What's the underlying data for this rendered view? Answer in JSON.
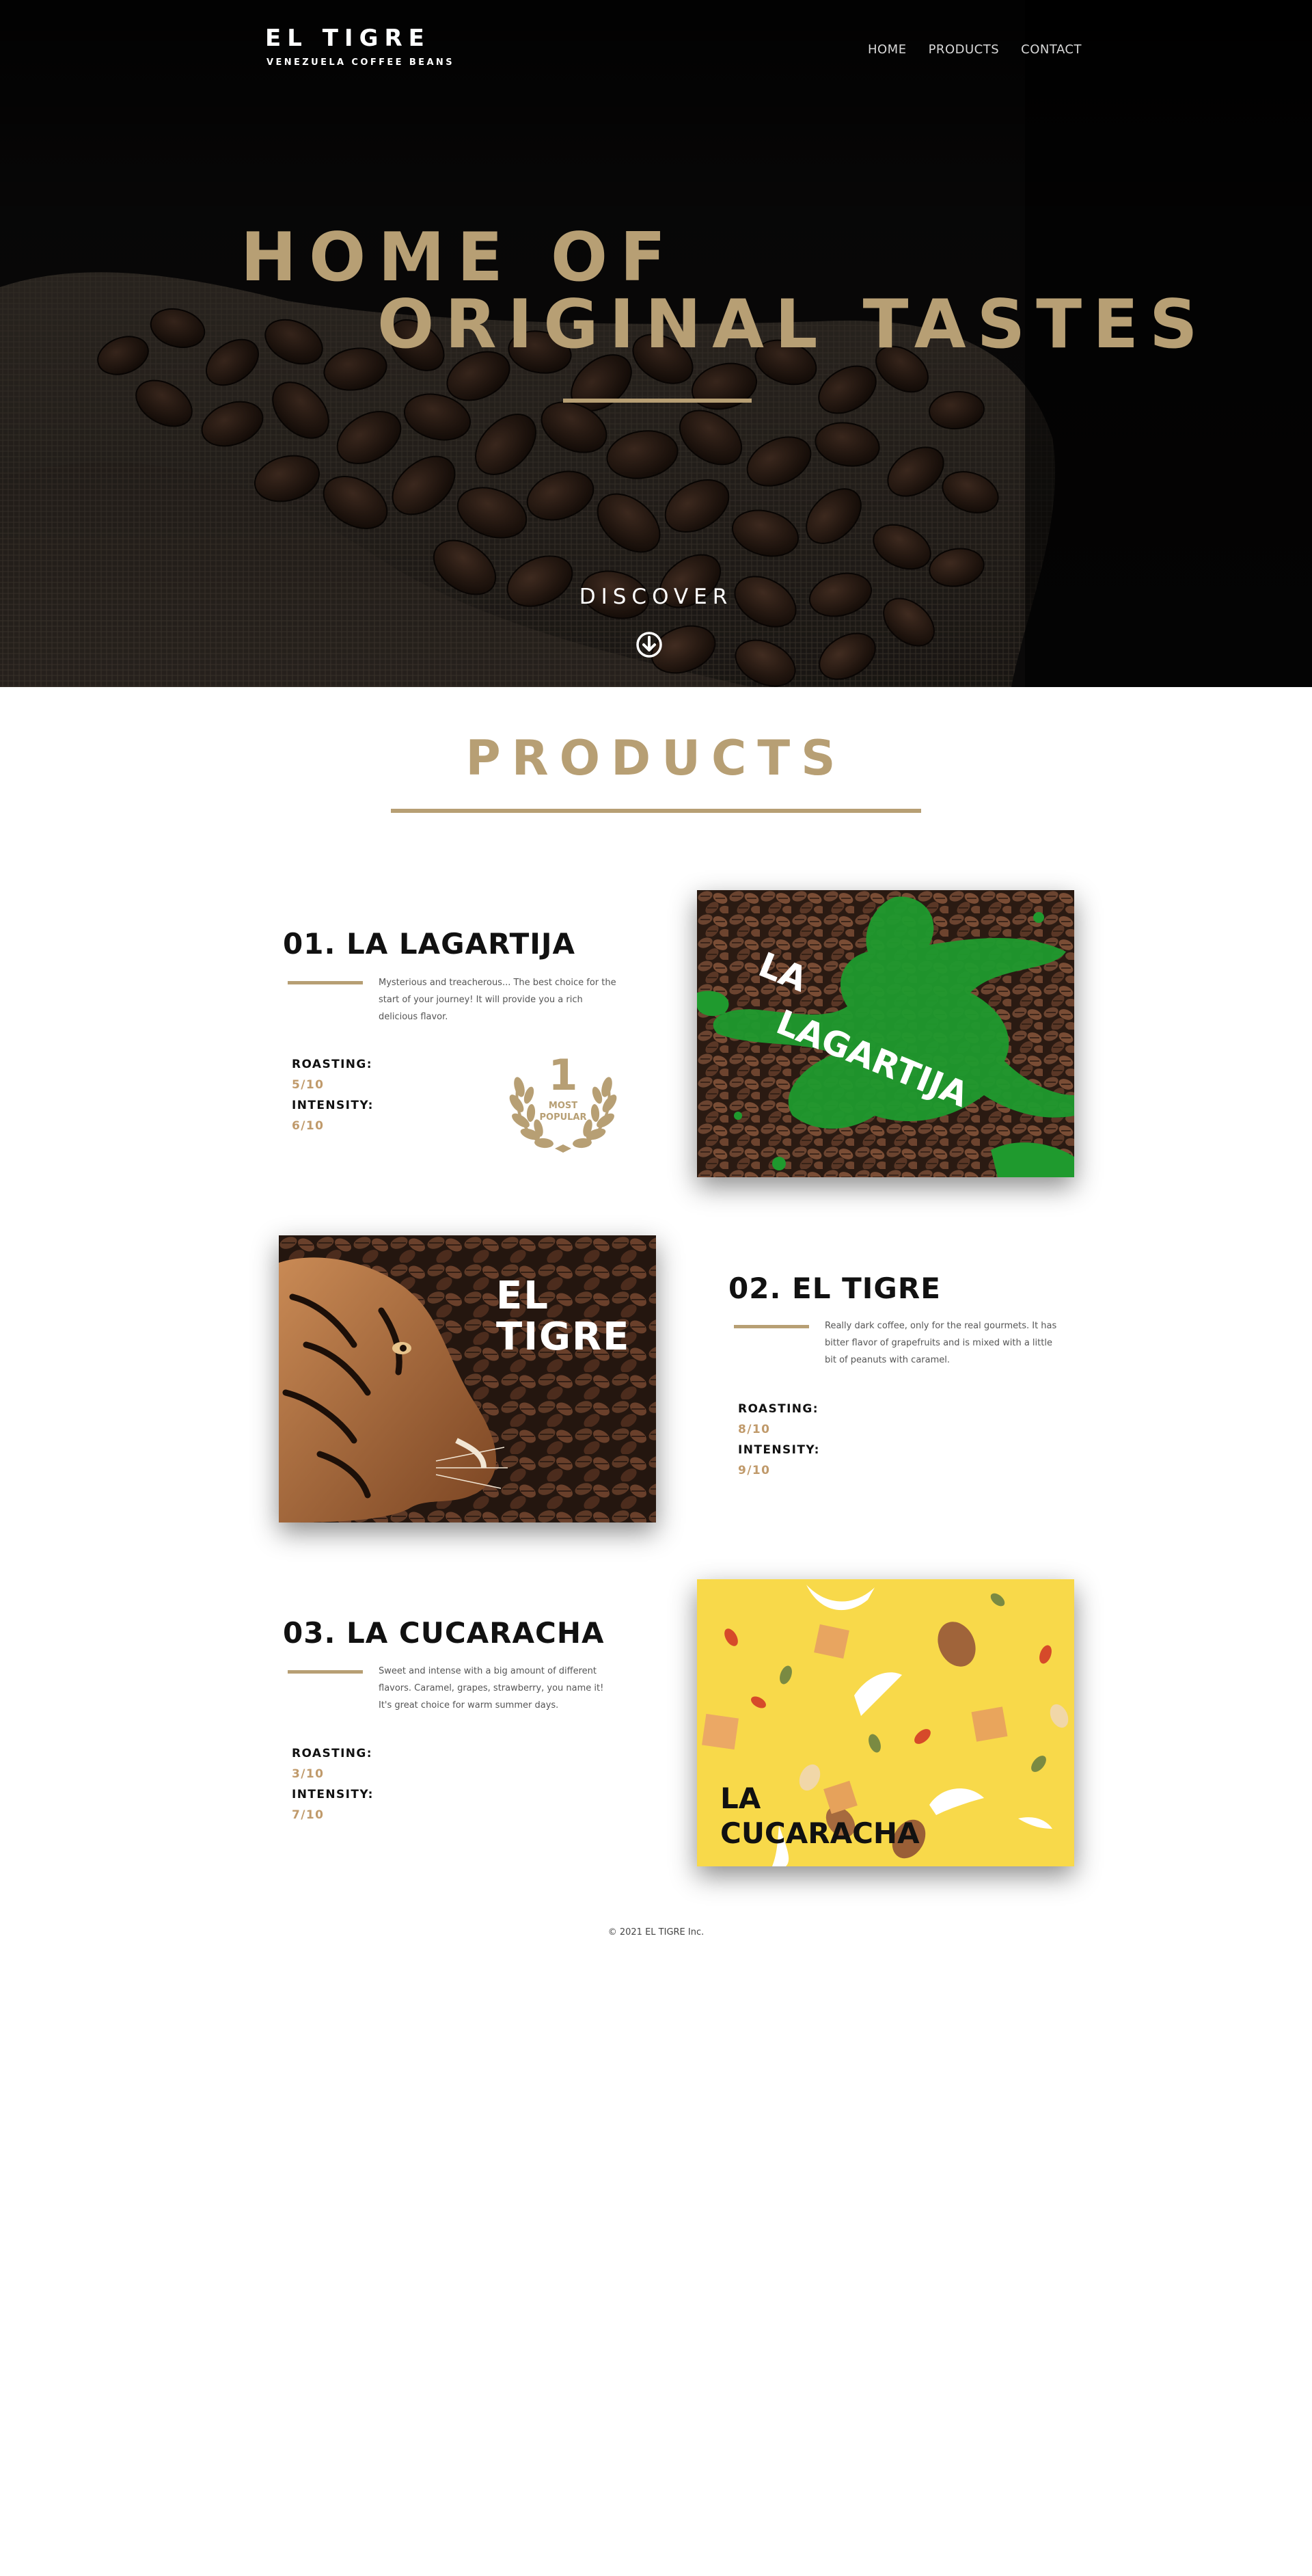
{
  "brand": {
    "title": "EL TIGRE",
    "subtitle": "VENEZUELA COFFEE BEANS"
  },
  "nav": {
    "items": [
      "HOME",
      "PRODUCTS",
      "CONTACT"
    ]
  },
  "hero": {
    "line1": "HOME OF",
    "line2": "ORIGINAL TASTES",
    "discover": "DISCOVER",
    "icon": "arrow-down-circle-icon"
  },
  "products_section": {
    "title": "PRODUCTS"
  },
  "products": [
    {
      "name": "01. LA LAGARTIJA",
      "description": "Mysterious and treacherous... The best choice for the start of your journey! It will provide you a rich delicious flavor.",
      "roasting_label": "ROASTING:",
      "roasting_value": "5/10",
      "intensity_label": "INTENSITY:",
      "intensity_value": "6/10",
      "image_label_1": "LA",
      "image_label_2": "LAGARTIJA",
      "badge": {
        "number": "1",
        "line1": "MOST",
        "line2": "POPULAR"
      }
    },
    {
      "name": "02. EL TIGRE",
      "description": "Really dark coffee, only for the real gourmets. It has bitter flavor of grapefruits and is mixed with a little bit of peanuts with caramel.",
      "roasting_label": "ROASTING:",
      "roasting_value": "8/10",
      "intensity_label": "INTENSITY:",
      "intensity_value": "9/10",
      "image_label_1": "EL",
      "image_label_2": "TIGRE"
    },
    {
      "name": "03. LA CUCARACHA",
      "description": "Sweet and intense with a big amount of different flavors. Caramel, grapes, strawberry, you name it! It's great choice for warm summer days.",
      "roasting_label": "ROASTING:",
      "roasting_value": "3/10",
      "intensity_label": "INTENSITY:",
      "intensity_value": "7/10",
      "image_label_1": "LA",
      "image_label_2": "CUCARACHA"
    }
  ],
  "footer": {
    "copyright": "© 2021 EL TIGRE Inc."
  },
  "colors": {
    "accent": "#b79f74",
    "value": "#c09a6b",
    "hero_bg": "#0a0a0a",
    "lizard_green": "#1f9a2e",
    "cucaracha_yellow": "#f8d94a"
  }
}
